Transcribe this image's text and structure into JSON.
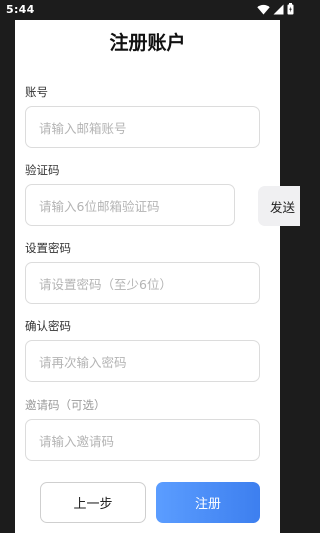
{
  "status_bar": {
    "time": "5:44",
    "icons": [
      "wifi-icon",
      "signal-icon",
      "battery-icon"
    ]
  },
  "page": {
    "title": "注册账户"
  },
  "form": {
    "account": {
      "label": "账号",
      "placeholder": "请输入邮箱账号"
    },
    "verification_code": {
      "label": "验证码",
      "placeholder": "请输入6位邮箱验证码",
      "send_button": "发送"
    },
    "password": {
      "label": "设置密码",
      "placeholder": "请设置密码（至少6位）"
    },
    "confirm_password": {
      "label": "确认密码",
      "placeholder": "请再次输入密码"
    },
    "invite_code": {
      "label": "邀请码（可选）",
      "placeholder": "请输入邀请码"
    }
  },
  "actions": {
    "back_label": "上一步",
    "register_label": "注册"
  },
  "colors": {
    "primary": "#4a8cf7",
    "placeholder": "#b4b4b4",
    "border": "#dcdcdc"
  }
}
